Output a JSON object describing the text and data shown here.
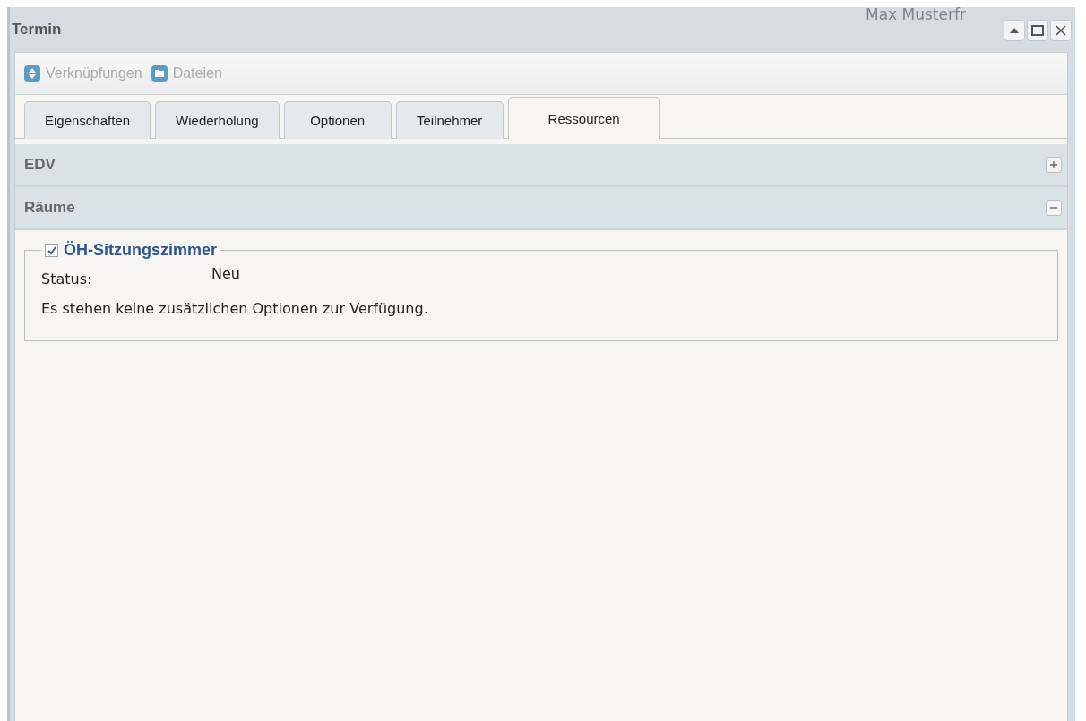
{
  "background_text": "Max Musterfr",
  "window": {
    "title": "Termin"
  },
  "toolbar": [
    {
      "label": "Verknüpfungen",
      "kind": "links"
    },
    {
      "label": "Dateien",
      "kind": "files"
    }
  ],
  "tabs": [
    {
      "label": "Eigenschaften",
      "selected": false
    },
    {
      "label": "Wiederholung",
      "selected": false
    },
    {
      "label": "Optionen",
      "selected": false
    },
    {
      "label": "Teilnehmer",
      "selected": false
    },
    {
      "label": "Ressourcen",
      "selected": true
    }
  ],
  "sections": [
    {
      "title": "EDV",
      "expanded": false
    },
    {
      "title": "Räume",
      "expanded": true,
      "resources": [
        {
          "name": "ÖH-Sitzungszimmer",
          "checked": true,
          "status_label": "Status:",
          "status": "Neu",
          "note": "Es stehen keine zusätzlichen Optionen zur Verfügung."
        }
      ]
    }
  ]
}
